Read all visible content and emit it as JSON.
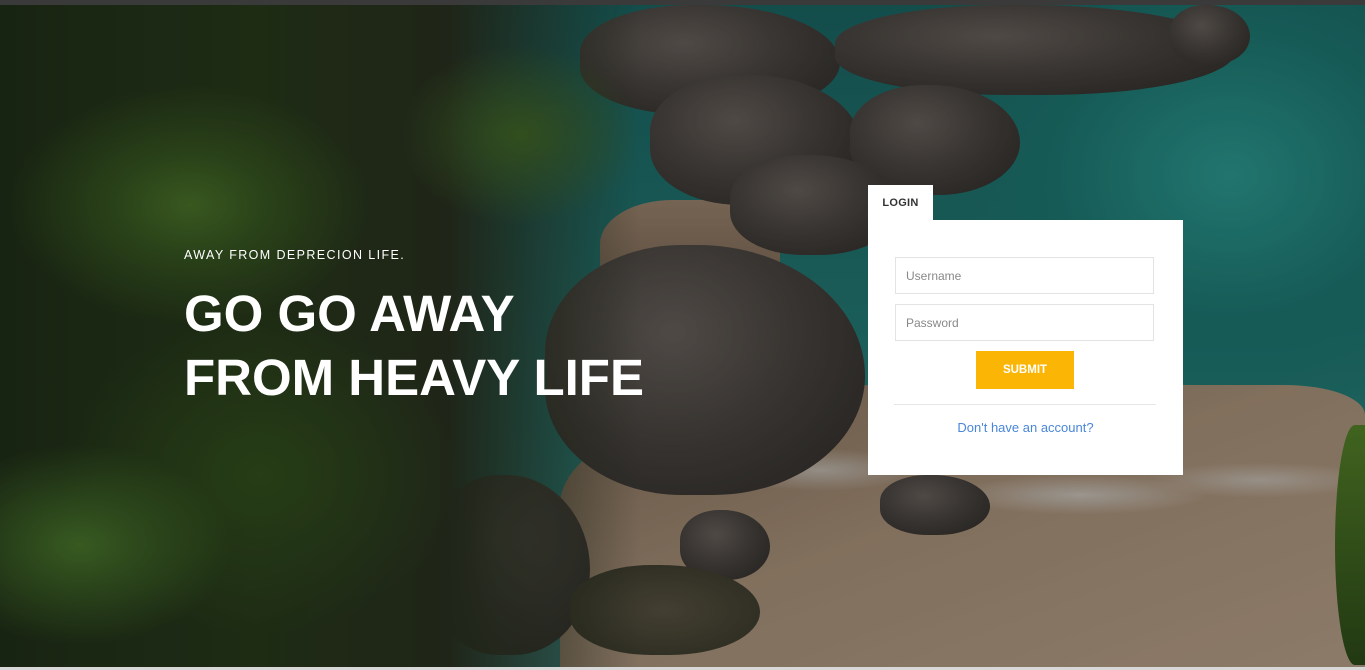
{
  "hero": {
    "tagline": "AWAY FROM DEPRECION LIFE.",
    "headline_line1": "GO GO AWAY",
    "headline_line2": "FROM HEAVY LIFE"
  },
  "login": {
    "tab_label": "LOGIN",
    "username_placeholder": "Username",
    "password_placeholder": "Password",
    "submit_label": "SUBMIT",
    "signup_link": "Don't have an account?"
  },
  "colors": {
    "accent": "#fbb605",
    "link": "#4a86d8"
  }
}
